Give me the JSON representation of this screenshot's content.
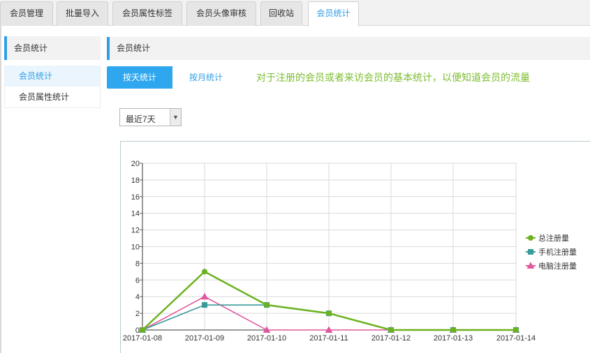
{
  "tabs": [
    {
      "label": "会员管理",
      "active": false
    },
    {
      "label": "批量导入",
      "active": false
    },
    {
      "label": "会员属性标签",
      "active": false
    },
    {
      "label": "会员头像审核",
      "active": false
    },
    {
      "label": "回收站",
      "active": false
    },
    {
      "label": "会员统计",
      "active": true
    }
  ],
  "sidebar": {
    "title": "会员统计",
    "items": [
      {
        "label": "会员统计",
        "active": true
      },
      {
        "label": "会员属性统计",
        "active": false
      }
    ]
  },
  "main": {
    "title": "会员统计",
    "buttons": {
      "day": "按天统计",
      "month": "按月统计"
    },
    "description": "对于注册的会员或者来访会员的基本统计，以便知道会员的流量",
    "range_select": {
      "value": "最近7天"
    }
  },
  "colors": {
    "accent": "#2f9ee8",
    "description": "#7cbd2e"
  },
  "chart_data": {
    "type": "line",
    "x": [
      "2017-01-08",
      "2017-01-09",
      "2017-01-10",
      "2017-01-11",
      "2017-01-12",
      "2017-01-13",
      "2017-01-14"
    ],
    "ylim": [
      0,
      20
    ],
    "yticks": [
      0,
      2,
      4,
      6,
      8,
      10,
      12,
      14,
      16,
      18,
      20
    ],
    "grid": true,
    "legend": "right",
    "series": [
      {
        "name": "总注册量",
        "color": "#6cb21f",
        "marker": "circle",
        "values": [
          0,
          7,
          3,
          2,
          0,
          0,
          0
        ]
      },
      {
        "name": "手机注册量",
        "color": "#3a9a9a",
        "marker": "square",
        "values": [
          0,
          3,
          3,
          2,
          0,
          0,
          0
        ]
      },
      {
        "name": "电脑注册量",
        "color": "#e0579e",
        "marker": "triangle",
        "values": [
          0,
          4,
          0,
          0,
          0,
          0,
          0
        ]
      }
    ]
  }
}
